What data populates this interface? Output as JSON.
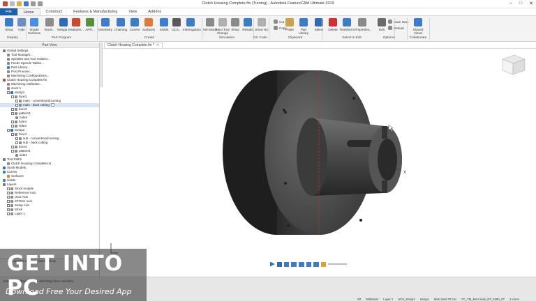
{
  "window": {
    "title": "Clutch Housing Complete.fm (Turning) - Autodesk FeatureCAM Ultimate 2019",
    "controls": [
      "–",
      "□",
      "✕"
    ]
  },
  "tabs": [
    "File",
    "Home",
    "Construct",
    "Features & Manufacturing",
    "View",
    "Add-Ins"
  ],
  "active_tab": "Home",
  "ribbon": {
    "buttons": [
      {
        "label": "Show",
        "icon": "show-icon",
        "color": "#3d7cc9"
      },
      {
        "label": "Hide",
        "icon": "hide-icon",
        "color": "#6a8fc0"
      },
      {
        "label": "Shade Surfaces",
        "icon": "shade-surfaces-icon",
        "color": "#4a90e2"
      },
      {
        "label": "Stock...",
        "icon": "stock-icon",
        "color": "#8d8d8d"
      },
      {
        "label": "Setups...",
        "icon": "setups-icon",
        "color": "#2e6db4"
      },
      {
        "label": "Features...",
        "icon": "features-icon",
        "color": "#c84b2f"
      },
      {
        "label": "APR...",
        "icon": "apr-icon",
        "color": "#5a8f3c"
      },
      {
        "label": "Geometry",
        "icon": "geometry-icon",
        "color": "#3d7cc9"
      },
      {
        "label": "Chaining",
        "icon": "chaining-icon",
        "color": "#3d7cc9"
      },
      {
        "label": "Curves",
        "icon": "curves-icon",
        "color": "#3d7cc9"
      },
      {
        "label": "Surfaces",
        "icon": "surfaces-icon",
        "color": "#e07a3a"
      },
      {
        "label": "Solids",
        "icon": "solids-icon",
        "color": "#3a7fd0"
      },
      {
        "label": "UCS...",
        "icon": "ucs-icon",
        "color": "#5a5a5a"
      },
      {
        "label": "Interrogation",
        "icon": "interrogation-icon",
        "color": "#3d7cc9"
      },
      {
        "label": "Sim Mode",
        "icon": "sim-mode-icon",
        "color": "#8a8a8a"
      },
      {
        "label": "Next Tool Change",
        "icon": "next-tool-change-icon",
        "color": "#b0b0b0"
      },
      {
        "label": "Show",
        "icon": "show-sim-icon",
        "color": "#8a8a8a"
      },
      {
        "label": "Results",
        "icon": "results-icon",
        "color": "#3d7cc9"
      },
      {
        "label": "Show NC",
        "icon": "show-nc-icon",
        "color": "#b0b0b0"
      },
      {
        "label": "Paste",
        "icon": "paste-icon",
        "color": "#c9a24a"
      },
      {
        "label": "Part Library",
        "icon": "part-library-icon",
        "color": "#3d7cc9"
      },
      {
        "label": "Select",
        "icon": "select-icon",
        "color": "#2e6db4"
      },
      {
        "label": "Delete",
        "icon": "delete-icon",
        "color": "#d03030"
      },
      {
        "label": "Transform...",
        "icon": "transform-icon",
        "color": "#3d7cc9"
      },
      {
        "label": "Properties...",
        "icon": "properties-icon",
        "color": "#8a8a8a"
      },
      {
        "label": "Edit",
        "icon": "edit-icon",
        "color": "#6a6a6a"
      },
      {
        "label": "Shared Views",
        "icon": "shared-views-icon",
        "color": "#3d7cc9"
      }
    ],
    "small_buttons": [
      {
        "label": "Cut",
        "icon": "cut-icon"
      },
      {
        "label": "Copy",
        "icon": "copy-icon"
      },
      {
        "label": "Save Now",
        "icon": "save-now-icon"
      },
      {
        "label": "Reload",
        "icon": "reload-icon"
      }
    ],
    "groups": [
      "Display",
      "Part Program",
      "Create",
      "Simulation",
      "NC Code",
      "Clipboard",
      "Select & Edit",
      "Options",
      "Collaborate"
    ]
  },
  "left_panel": {
    "title": "Part View",
    "tree": [
      {
        "label": "Global Settings",
        "indent": 0,
        "color": "#7a7a7a"
      },
      {
        "label": "Tool Manager...",
        "indent": 1,
        "color": "#8a8a8a"
      },
      {
        "label": "Spindles and Tool Holders...",
        "indent": 1,
        "color": "#8a8a8a"
      },
      {
        "label": "Feeds Speeds Tables...",
        "indent": 1,
        "color": "#8a8a8a"
      },
      {
        "label": "Part Library...",
        "indent": 1,
        "color": "#3d7cc9"
      },
      {
        "label": "Post Process...",
        "indent": 1,
        "color": "#8a8a8a"
      },
      {
        "label": "Machining Configurations...",
        "indent": 1,
        "color": "#8a8a8a"
      },
      {
        "label": "Clutch Housing Complete.fm",
        "indent": 0,
        "color": "#c84b2f"
      },
      {
        "label": "Machining Attributes...",
        "indent": 1,
        "color": "#8a8a8a"
      },
      {
        "label": "stock 1",
        "indent": 1,
        "color": "#8a8a8a"
      },
      {
        "label": "Setup1",
        "indent": 1,
        "color": "#2e6db4",
        "check": true
      },
      {
        "label": "face3",
        "indent": 2,
        "color": "#8a8a8a",
        "check": true
      },
      {
        "label": "main - conventional turning",
        "indent": 3,
        "color": "#8a8a8a",
        "check": true
      },
      {
        "label": "main - back cutting",
        "indent": 3,
        "color": "#8a8a8a",
        "check": true,
        "selected": true,
        "dropdown": true
      },
      {
        "label": "bore3",
        "indent": 2,
        "color": "#8a8a8a",
        "check": true
      },
      {
        "label": "pattern3",
        "indent": 2,
        "color": "#8a8a8a",
        "check": true
      },
      {
        "label": "hole3",
        "indent": 3,
        "color": "#8a8a8a"
      },
      {
        "label": "hole4",
        "indent": 2,
        "color": "#8a8a8a",
        "check": true
      },
      {
        "label": "side3",
        "indent": 2,
        "color": "#8a8a8a",
        "check": true
      },
      {
        "label": "Setup2",
        "indent": 1,
        "color": "#2e6db4",
        "check": true
      },
      {
        "label": "face4",
        "indent": 2,
        "color": "#8a8a8a",
        "check": true
      },
      {
        "label": "sub - conventional turning",
        "indent": 3,
        "color": "#8a8a8a",
        "check": true
      },
      {
        "label": "sub - back cutting",
        "indent": 3,
        "color": "#8a8a8a",
        "check": true
      },
      {
        "label": "bore4",
        "indent": 2,
        "color": "#8a8a8a",
        "check": true
      },
      {
        "label": "pattern4",
        "indent": 2,
        "color": "#8a8a8a",
        "check": true
      },
      {
        "label": "side4",
        "indent": 3,
        "color": "#8a8a8a"
      },
      {
        "label": "Tool Paths",
        "indent": 0,
        "color": "#7a7a7a"
      },
      {
        "label": "Clutch Housing Complete.txt",
        "indent": 1,
        "color": "#8a8a8a"
      },
      {
        "label": "Stock Models",
        "indent": 0,
        "color": "#2e6db4"
      },
      {
        "label": "Curves",
        "indent": 0,
        "color": "#3d7cc9"
      },
      {
        "label": "Surfaces",
        "indent": 1,
        "color": "#e07a3a"
      },
      {
        "label": "Solids",
        "indent": 0,
        "color": "#3a7fd0"
      },
      {
        "label": "Layers",
        "indent": 0,
        "color": "#7a7a7a"
      },
      {
        "label": "Stock models",
        "indent": 1,
        "color": "#8a8a8a",
        "check": true
      },
      {
        "label": "Reference Axis",
        "indent": 1,
        "color": "#8a8a8a",
        "check": true
      },
      {
        "label": "UCS Axis",
        "indent": 1,
        "color": "#8a8a8a",
        "check": true
      },
      {
        "label": "STOCK Axis",
        "indent": 1,
        "color": "#8a8a8a",
        "check": true
      },
      {
        "label": "Setup Axis",
        "indent": 1,
        "color": "#8a8a8a",
        "check": true
      },
      {
        "label": "Stock",
        "indent": 1,
        "color": "#8a8a8a",
        "check": true
      },
      {
        "label": "Layer 1",
        "indent": 1,
        "color": "#8a8a8a",
        "check": true
      }
    ],
    "bottom": [
      "Properties of 'main - back cutting'"
    ]
  },
  "viewport": {
    "tab_label": "Clutch Housing Complete.fm *",
    "tab_close": "✕",
    "axis_label_x": "X"
  },
  "status": {
    "hint": "Select something, or click and drag a box selection.",
    "right": [
      "XZ",
      "Millimeter",
      "Layer 1",
      "UCS_Setup1",
      "Setup1",
      "Mori Seiki NT.cnc",
      "FC_TM_Mori Seiki_NT_6250_ST",
      "4 cores"
    ]
  },
  "watermark": {
    "big": "GET INTO PC",
    "small": "Download Free Your Desired App"
  }
}
